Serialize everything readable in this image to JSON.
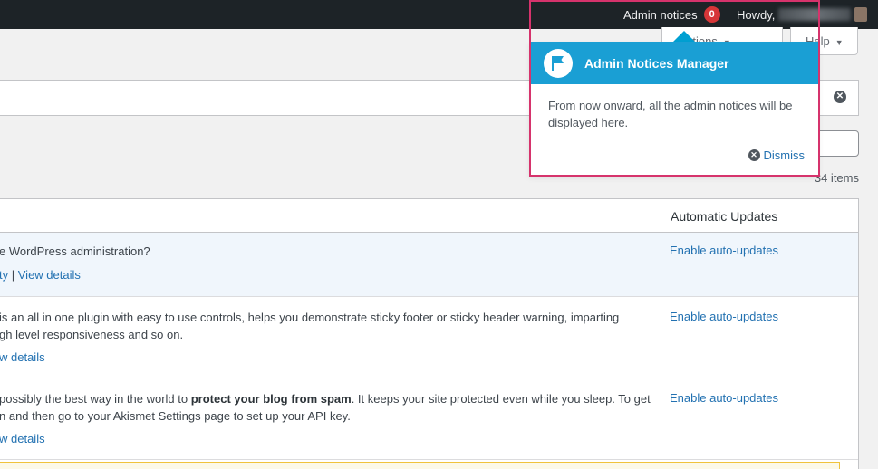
{
  "adminbar": {
    "notices_label": "Admin notices",
    "notices_count": "0",
    "howdy": "Howdy,"
  },
  "screen_tabs": {
    "options_label": "Options",
    "help_label": "Help"
  },
  "items_count": "34 items",
  "table": {
    "col_auto_updates": "Automatic Updates",
    "rows": [
      {
        "desc1": "e WordPress administration?",
        "desc2": "",
        "actions_a": "ty",
        "actions_b": "View details",
        "auto": "Enable auto-updates"
      },
      {
        "desc1": " is an all in one plugin with easy to use controls, helps you demonstrate sticky footer or sticky header warning, imparting",
        "desc2": "gh level responsiveness and so on.",
        "actions_b": "w details",
        "auto": "Enable auto-updates"
      },
      {
        "desc1_pre": "possibly the best way in the world to ",
        "desc1_bold": "protect your blog from spam",
        "desc1_post": ". It keeps your site protected even while you sleep. To get",
        "desc2": "n and then go to your Akismet Settings page to set up your API key.",
        "actions_b": "w details",
        "auto": "Enable auto-updates"
      }
    ]
  },
  "popover": {
    "title": "Admin Notices Manager",
    "body": "From now onward, all the admin notices will be displayed here.",
    "dismiss": "Dismiss"
  },
  "icons": {
    "flag": "flag-icon",
    "close": "close-circle-icon",
    "caret": "caret-down-icon"
  },
  "colors": {
    "adminbar": "#1d2327",
    "popover_header": "#1a9fd4",
    "highlight": "#d6336c",
    "link": "#2271b1",
    "badge": "#d63638"
  }
}
